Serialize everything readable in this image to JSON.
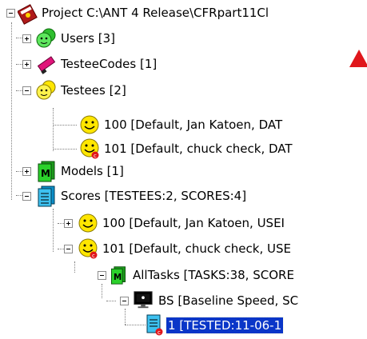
{
  "colors": {
    "selection": "#0a36c8",
    "arrow": "#e0161b",
    "smiley": "#ffe600"
  },
  "tree": {
    "project": {
      "label": "Project C:\\ANT 4 Release\\CFRpart11Cl",
      "icon": "book-icon"
    },
    "users": {
      "label": "Users [3]",
      "icon": "users-group-icon"
    },
    "testeecodes": {
      "label": "TesteeCodes [1]",
      "icon": "marker-icon"
    },
    "testees": {
      "label": "Testees [2]",
      "icon": "testees-group-icon"
    },
    "testee100": {
      "label": "100 [Default, Jan Katoen, DAT",
      "icon": "smiley-icon"
    },
    "testee101": {
      "label": "101 [Default, chuck check, DAT",
      "icon": "smiley-checked-icon"
    },
    "models": {
      "label": "Models [1]",
      "icon": "model-icon"
    },
    "scores": {
      "label": "Scores [TESTEES:2, SCORES:4]",
      "icon": "scores-icon"
    },
    "score100": {
      "label": "100 [Default, Jan Katoen, USEI",
      "icon": "smiley-icon"
    },
    "score101": {
      "label": "101 [Default, chuck check, USE",
      "icon": "smiley-checked-icon"
    },
    "alltasks": {
      "label": "AllTasks [TASKS:38, SCORE",
      "icon": "model-icon"
    },
    "bs": {
      "label": "BS [Baseline Speed, SC",
      "icon": "monitor-icon"
    },
    "record1": {
      "label": "1 [TESTED:11-06-1",
      "icon": "document-icon"
    }
  }
}
